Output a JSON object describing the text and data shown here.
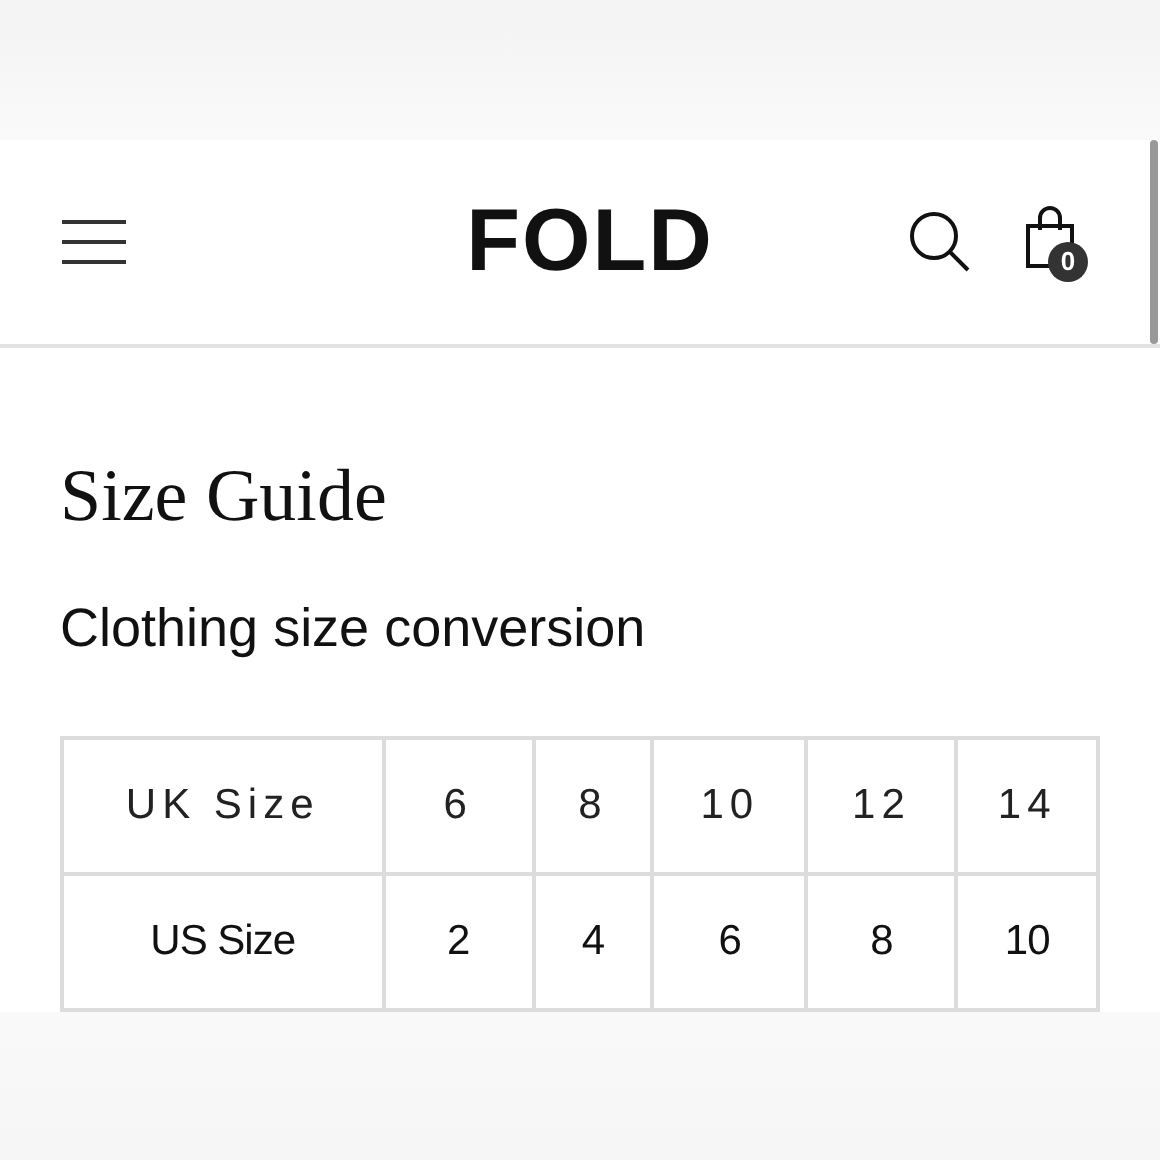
{
  "header": {
    "logo": "FOLD",
    "cart_count": "0"
  },
  "title": "Size Guide",
  "subtitle": "Clothing size conversion",
  "table": {
    "rows": [
      {
        "kind": "spaced",
        "cells": [
          "UK Size",
          "6",
          "8",
          "10",
          "12",
          "14"
        ]
      },
      {
        "kind": "plain",
        "cells": [
          "US Size",
          "2",
          "4",
          "6",
          "8",
          "10"
        ]
      }
    ]
  }
}
